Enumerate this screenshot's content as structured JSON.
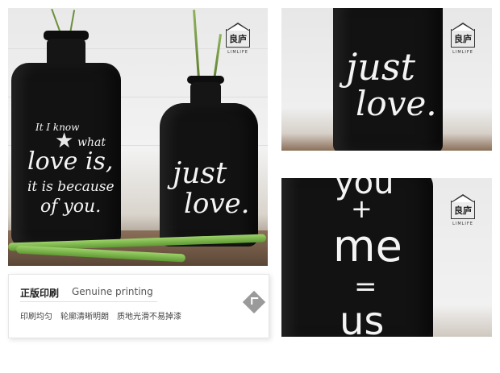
{
  "main_photo": {
    "large_bottle_text": [
      "It I know",
      "what",
      "love is,",
      "it is because",
      "of you."
    ],
    "small_bottle_text": [
      "just",
      "love."
    ]
  },
  "top_right_photo": {
    "bottle_text": [
      "just",
      "love."
    ]
  },
  "bottom_right_photo": {
    "bottle_text": [
      "you",
      "+",
      "me",
      "=",
      "us"
    ]
  },
  "logo": {
    "glyph": "良庐",
    "brand": "LIMLIFE"
  },
  "caption": {
    "title": "正版印刷",
    "subtitle": "Genuine printing",
    "items": [
      "印刷均匀",
      "轮廓清晰明朗",
      "质地光滑不易掉漆"
    ]
  },
  "colors": {
    "bottle": "#121212",
    "lettering": "#f4f4f4",
    "button": "#9a9a9a"
  },
  "icons": {
    "logo": "house-logo-icon",
    "nav": "diamond-arrow-icon"
  }
}
